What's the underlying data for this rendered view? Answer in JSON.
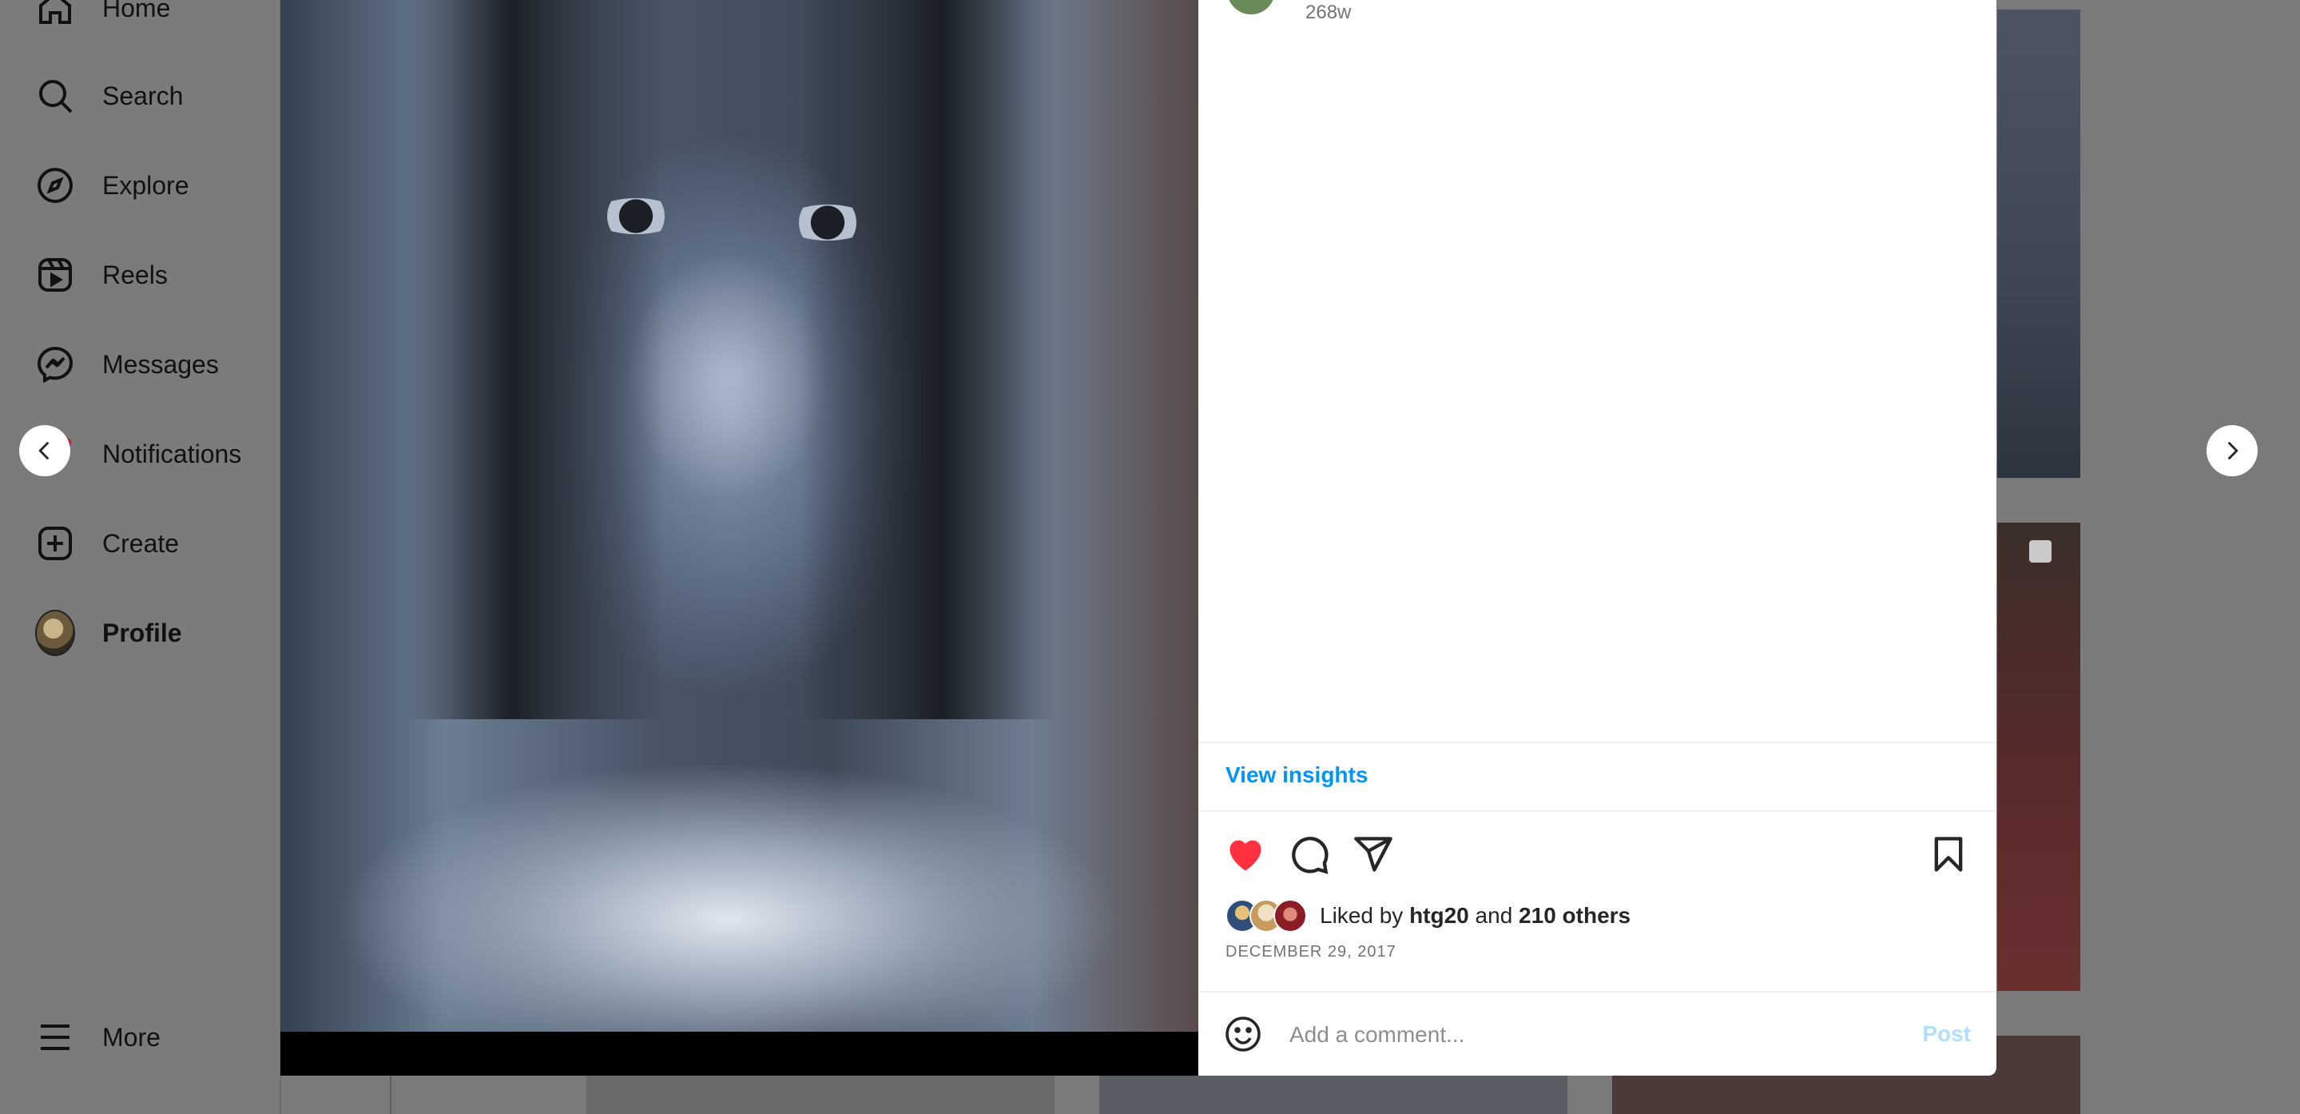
{
  "sidebar": {
    "items": [
      {
        "label": "Home",
        "icon": "home-icon"
      },
      {
        "label": "Search",
        "icon": "search-icon"
      },
      {
        "label": "Explore",
        "icon": "compass-icon"
      },
      {
        "label": "Reels",
        "icon": "reels-icon"
      },
      {
        "label": "Messages",
        "icon": "messenger-icon"
      },
      {
        "label": "Notifications",
        "icon": "heart-icon"
      },
      {
        "label": "Create",
        "icon": "plus-square-icon"
      },
      {
        "label": "Profile",
        "icon": "avatar"
      }
    ],
    "more_label": "More"
  },
  "post": {
    "age": "268w",
    "view_insights": "View insights",
    "liked_by_prefix": "Liked by",
    "liked_by_user": "htg20",
    "liked_by_and": "and",
    "liked_by_others": "210 others",
    "date": "DECEMBER 29, 2017",
    "liked": true,
    "like_color": "#ff3040"
  },
  "comment": {
    "placeholder": "Add a comment...",
    "post_label": "Post"
  },
  "colors": {
    "link": "#0095f6",
    "post_disabled": "#b2dffc",
    "overlay": "#7a7a7a"
  }
}
